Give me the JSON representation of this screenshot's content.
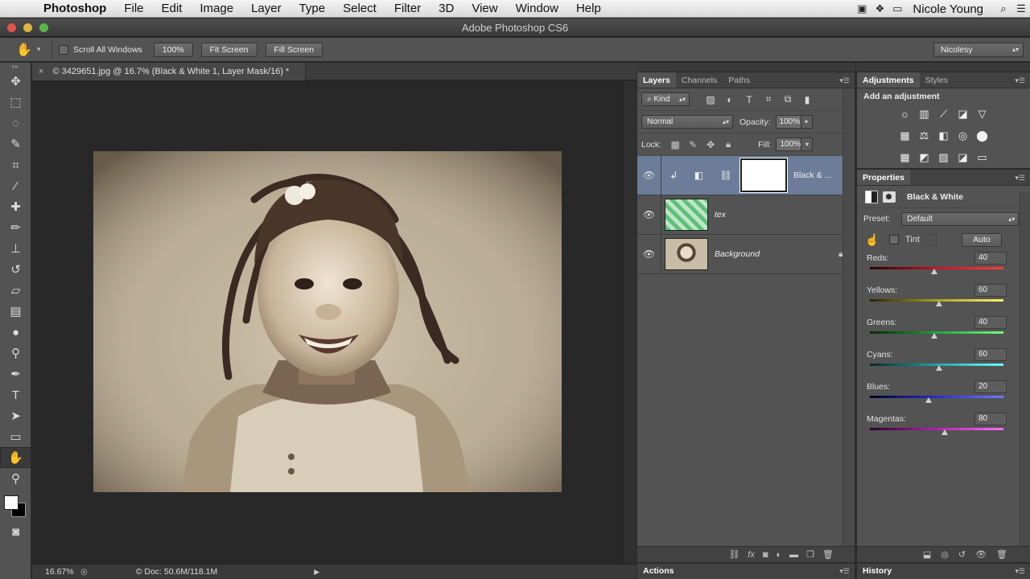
{
  "menubar": {
    "apple": "",
    "app": "Photoshop",
    "items": [
      "File",
      "Edit",
      "Image",
      "Layer",
      "Type",
      "Select",
      "Filter",
      "3D",
      "View",
      "Window",
      "Help"
    ],
    "user": "Nicole Young"
  },
  "window": {
    "title": "Adobe Photoshop CS6"
  },
  "options": {
    "scroll_all_windows": "Scroll All Windows",
    "zoom_100": "100%",
    "fit_screen": "Fit Screen",
    "fill_screen": "Fill Screen",
    "workspace": "Nicolesy"
  },
  "document": {
    "tab_title": "© 3429651.jpg @ 16.7% (Black & White 1, Layer Mask/16) *",
    "zoom": "16.67%",
    "doc_info": "© Doc: 50.6M/118.1M"
  },
  "layers_panel": {
    "tabs": [
      "Layers",
      "Channels",
      "Paths"
    ],
    "filter_kind": "Kind",
    "blend_mode": "Normal",
    "opacity_label": "Opacity:",
    "opacity": "100%",
    "lock_label": "Lock:",
    "fill_label": "Fill:",
    "fill": "100%",
    "layers": [
      {
        "name": "Black & ...",
        "type": "adjustment",
        "visible": true,
        "selected": true
      },
      {
        "name": "tex",
        "type": "smart-object",
        "visible": true,
        "selected": false
      },
      {
        "name": "Background",
        "type": "background",
        "visible": true,
        "selected": false,
        "locked": true
      }
    ]
  },
  "bottom_panels": {
    "actions": "Actions",
    "history": "History"
  },
  "adjustments_panel": {
    "tabs": [
      "Adjustments",
      "Styles"
    ],
    "title": "Add an adjustment"
  },
  "properties_panel": {
    "tab": "Properties",
    "adjustment_name": "Black & White",
    "preset_label": "Preset:",
    "preset": "Default",
    "tint_label": "Tint",
    "auto_label": "Auto",
    "sliders": [
      {
        "label": "Reds:",
        "value": "40",
        "level": 0.48,
        "gradient": "linear-gradient(90deg,#2b0000,#c8122a,#ff3b3b)"
      },
      {
        "label": "Yellows:",
        "value": "60",
        "level": 0.52,
        "gradient": "linear-gradient(90deg,#2b2400,#a6a319,#fff46a)"
      },
      {
        "label": "Greens:",
        "value": "40",
        "level": 0.48,
        "gradient": "linear-gradient(90deg,#002b05,#1fa33a,#6dff7c)"
      },
      {
        "label": "Cyans:",
        "value": "60",
        "level": 0.52,
        "gradient": "linear-gradient(90deg,#002b2b,#1ba6a3,#6dfdff)"
      },
      {
        "label": "Blues:",
        "value": "20",
        "level": 0.44,
        "gradient": "linear-gradient(90deg,#00002b,#2230c8,#6b7cff)"
      },
      {
        "label": "Magentas:",
        "value": "80",
        "level": 0.56,
        "gradient": "linear-gradient(90deg,#2b002b,#b222b0,#ff6bff)"
      }
    ]
  }
}
